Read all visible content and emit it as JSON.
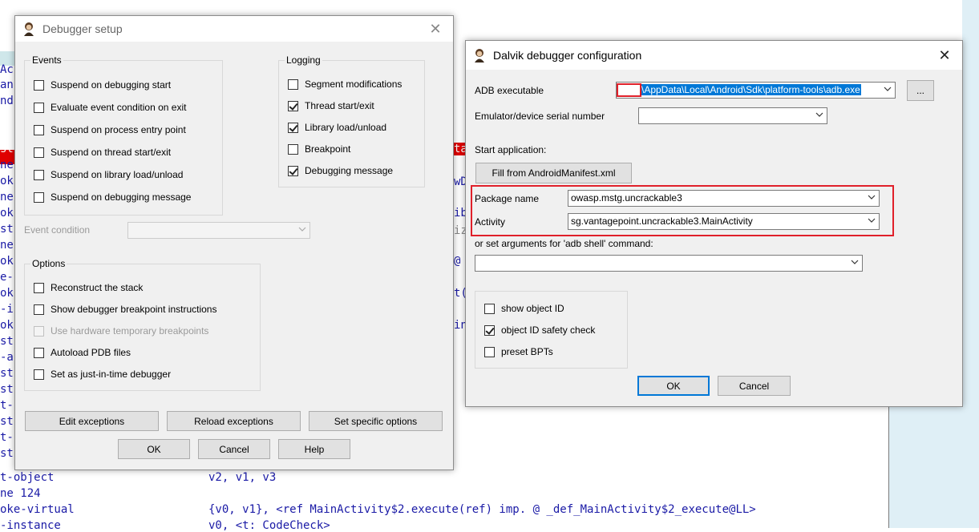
{
  "background_code": {
    "left_fragments": [
      "Ac",
      "an",
      "nd",
      "st",
      "ne",
      "ok",
      "ne",
      "ok",
      "st",
      "ne",
      "ok",
      "e-",
      "ok",
      "-i",
      "ok",
      "st",
      "-a",
      "st",
      "st",
      "t-",
      "st",
      "t-",
      "st"
    ],
    "mid_fragments": [
      "ta",
      "wD",
      "ib",
      "iz",
      "@",
      "t(",
      "in"
    ],
    "bottom_lines": [
      {
        "op": "t-object",
        "args": "v2, v1, v3"
      },
      {
        "op": "ne 124",
        "args": ""
      },
      {
        "op": "oke-virtual",
        "args": "{v0, v1}, <ref MainActivity$2.execute(ref) imp. @ _def_MainActivity$2_execute@LL>"
      },
      {
        "op": "-instance",
        "args": "v0, <t: CodeCheck>"
      }
    ]
  },
  "debugger_setup": {
    "title": "Debugger setup",
    "events": {
      "label": "Events",
      "items": [
        {
          "label": "Suspend on debugging start",
          "checked": false
        },
        {
          "label": "Evaluate event condition on exit",
          "checked": false
        },
        {
          "label": "Suspend on process entry point",
          "checked": false
        },
        {
          "label": "Suspend on thread start/exit",
          "checked": false
        },
        {
          "label": "Suspend on library load/unload",
          "checked": false
        },
        {
          "label": "Suspend on debugging message",
          "checked": false
        }
      ]
    },
    "logging": {
      "label": "Logging",
      "items": [
        {
          "label": "Segment modifications",
          "checked": false
        },
        {
          "label": "Thread start/exit",
          "checked": true
        },
        {
          "label": "Library load/unload",
          "checked": true
        },
        {
          "label": "Breakpoint",
          "checked": false
        },
        {
          "label": "Debugging message",
          "checked": true
        }
      ]
    },
    "event_condition_label": "Event condition",
    "event_condition_value": "",
    "options": {
      "label": "Options",
      "items": [
        {
          "label": "Reconstruct the stack",
          "checked": false,
          "disabled": false
        },
        {
          "label": "Show debugger breakpoint instructions",
          "checked": false,
          "disabled": false
        },
        {
          "label": "Use hardware temporary breakpoints",
          "checked": false,
          "disabled": true
        },
        {
          "label": "Autoload PDB files",
          "checked": false,
          "disabled": false
        },
        {
          "label": "Set as just-in-time debugger",
          "checked": false,
          "disabled": false
        }
      ]
    },
    "buttons": {
      "edit_exceptions": "Edit exceptions",
      "reload_exceptions": "Reload exceptions",
      "set_specific_options": "Set specific options",
      "ok": "OK",
      "cancel": "Cancel",
      "help": "Help"
    }
  },
  "dalvik_config": {
    "title": "Dalvik debugger configuration",
    "adb_label": "ADB executable",
    "adb_value": "\\AppData\\Local\\Android\\Sdk\\platform-tools\\adb.exe",
    "browse_label": "...",
    "serial_label": "Emulator/device serial number",
    "serial_value": "",
    "start_app_label": "Start application:",
    "fill_button": "Fill from AndroidManifest.xml",
    "package_label": "Package name",
    "package_value": "owasp.mstg.uncrackable3",
    "activity_label": "Activity",
    "activity_value": "sg.vantagepoint.uncrackable3.MainActivity",
    "args_label": "or set arguments for 'adb shell' command:",
    "args_value": "",
    "checks": [
      {
        "label": "show object ID",
        "checked": false
      },
      {
        "label": "object ID safety check",
        "checked": true
      },
      {
        "label": "preset BPTs",
        "checked": false
      }
    ],
    "ok": "OK",
    "cancel": "Cancel"
  },
  "colors": {
    "accent": "#0078d7",
    "highlight_box": "#e0202a",
    "code_blue": "#1a1aa6"
  }
}
